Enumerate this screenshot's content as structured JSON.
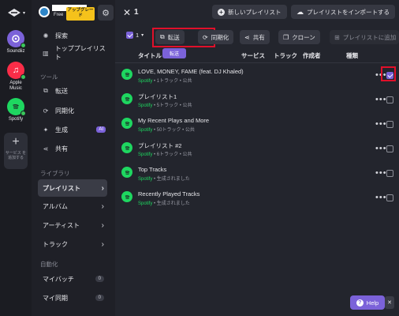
{
  "account": {
    "plan": "Free",
    "upgrade_label": "アップグレード"
  },
  "services": [
    {
      "name": "Soundiiz",
      "color": "#7b62d9"
    },
    {
      "name": "Apple\nMusic",
      "color": "#fa2d48"
    },
    {
      "name": "Spotify",
      "color": "#1ed760"
    }
  ],
  "rail": {
    "add_service_label": "サービス を追加する"
  },
  "sidebar": {
    "explore": "探索",
    "top_playlists": "トッププレイリスト",
    "tools_head": "ツール",
    "tools": [
      "転送",
      "同期化",
      "生成",
      "共有"
    ],
    "ai_badge": "AI",
    "library_head": "ライブラリ",
    "library": [
      "プレイリスト",
      "アルバム",
      "アーティスト",
      "トラック"
    ],
    "automation_head": "自動化",
    "automation": [
      {
        "label": "マイバッチ",
        "count": "0"
      },
      {
        "label": "マイ同期",
        "count": "0"
      }
    ]
  },
  "topbar": {
    "close_symbol": "✕",
    "selected_count": "1",
    "new_playlist": "新しいプレイリスト",
    "import_playlist": "プレイリストをインポートする"
  },
  "actions": {
    "select_count": "1",
    "transfer": "転送",
    "sync": "同期化",
    "share": "共有",
    "clone": "クローン",
    "add_to_playlist": "プレイリストに追加",
    "tooltip": "転送"
  },
  "table": {
    "headers": [
      "タイトル",
      "サービス",
      "トラック",
      "作成者",
      "種類"
    ]
  },
  "playlists": [
    {
      "name": "LOVE, MONEY, FAME (feat. DJ Khaled)",
      "source": "Spotify",
      "detail": " • 1トラック • 公共",
      "checked": true
    },
    {
      "name": "プレイリスト1",
      "source": "Spotify",
      "detail": " • 5トラック • 公共",
      "checked": false
    },
    {
      "name": "My Recent Plays and More",
      "source": "Spotify",
      "detail": " • 50トラック • 公共",
      "checked": false
    },
    {
      "name": "プレイリスト #2",
      "source": "Spotify",
      "detail": " • 6トラック • 公共",
      "checked": false
    },
    {
      "name": "Top Tracks",
      "source": "Spotify",
      "detail": " • 生成されました",
      "checked": false
    },
    {
      "name": "Recently Played Tracks",
      "source": "Spotify",
      "detail": " • 生成されました",
      "checked": false
    }
  ],
  "help": {
    "label": "Help",
    "close": "✕"
  }
}
